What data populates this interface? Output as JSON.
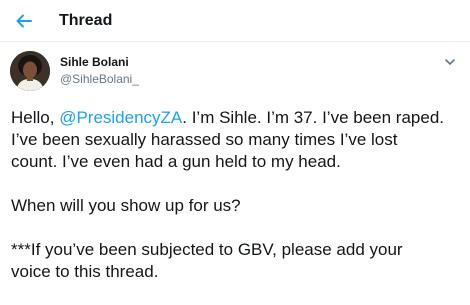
{
  "header": {
    "title": "Thread",
    "back_icon": "arrow-left-icon",
    "accent": "#1da1f2"
  },
  "tweet": {
    "author_name": "Sihle Bolani",
    "author_handle": "@SihleBolani_",
    "menu_icon": "chevron-down-icon",
    "text": {
      "greeting": "Hello, ",
      "mention": "@PresidencyZA",
      "line1_rest": ". I’m Sihle. I’m 37. I’ve been raped.",
      "line2": "I’ve been sexually harassed so many times I’ve lost",
      "line3": "count. I’ve even had a gun held to my head.",
      "line4": "When will you show up for us?",
      "line5": "***If you’ve been subjected to GBV, please add your",
      "line6": "voice to this thread."
    }
  }
}
